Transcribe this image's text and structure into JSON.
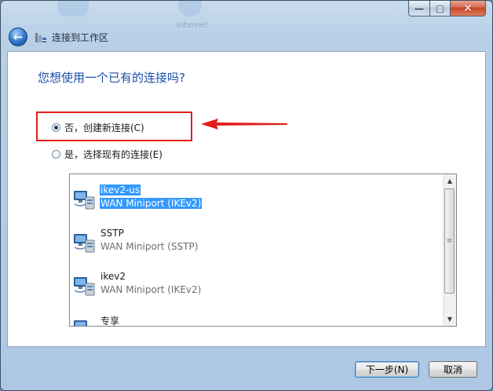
{
  "window": {
    "title": "连接到工作区",
    "background_icon_label": "Internet",
    "caption": {
      "minimize": "—",
      "maximize": "□",
      "close": "✕"
    }
  },
  "page": {
    "heading": "您想使用一个已有的连接吗?",
    "options": [
      {
        "label": "否，创建新连接(C)",
        "selected": true
      },
      {
        "label": "是，选择现有的连接(E)",
        "selected": false
      }
    ]
  },
  "connections": [
    {
      "name": "ikev2-us",
      "type": "WAN Miniport (IKEv2)",
      "selected": true,
      "icon": "network-connection-icon"
    },
    {
      "name": "SSTP",
      "type": "WAN Miniport (SSTP)",
      "selected": false,
      "icon": "network-connection-icon"
    },
    {
      "name": "ikev2",
      "type": "WAN Miniport (IKEv2)",
      "selected": false,
      "icon": "network-connection-icon"
    },
    {
      "name": "专享",
      "type": "",
      "selected": false,
      "icon": "network-connection-icon"
    }
  ],
  "buttons": {
    "next": "下一步(N)",
    "cancel": "取消"
  },
  "colors": {
    "highlight": "#e11c1c",
    "selection": "#3399ff",
    "heading": "#1b50a7"
  }
}
